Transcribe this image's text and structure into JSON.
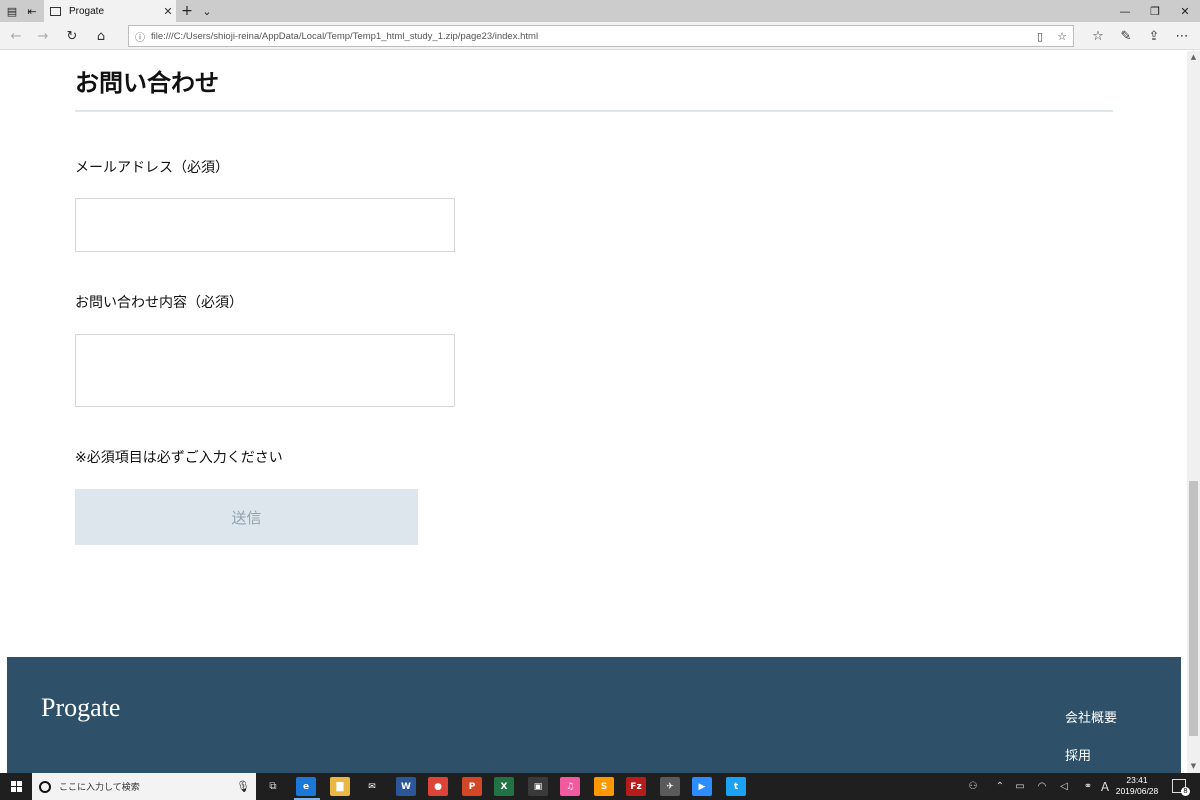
{
  "browser": {
    "tab_title": "Progate",
    "tab_close": "✕",
    "new_tab": "+",
    "tab_list": "⌄",
    "url": "file:///C:/Users/shioji-reina/AppData/Local/Temp/Temp1_html_study_1.zip/page23/index.html"
  },
  "page": {
    "heading": "お問い合わせ",
    "email_label": "メールアドレス（必須）",
    "email_value": "",
    "message_label": "お問い合わせ内容（必須）",
    "message_value": "",
    "required_note": "※必須項目は必ずご入力ください",
    "submit_label": "送信"
  },
  "footer": {
    "logo": "Progate",
    "links": [
      "会社概要",
      "採用"
    ]
  },
  "taskbar": {
    "search_placeholder": "ここに入力して検索",
    "apps": [
      {
        "name": "edge",
        "glyph": "e",
        "color": "#1c78d6"
      },
      {
        "name": "file-explorer",
        "glyph": "▇",
        "color": "#e8b842"
      },
      {
        "name": "mail",
        "glyph": "✉",
        "color": "#1f1f1f"
      },
      {
        "name": "word",
        "glyph": "W",
        "color": "#2b579a"
      },
      {
        "name": "chrome",
        "glyph": "●",
        "color": "#db4437"
      },
      {
        "name": "powerpoint",
        "glyph": "P",
        "color": "#d24726"
      },
      {
        "name": "excel",
        "glyph": "X",
        "color": "#217346"
      },
      {
        "name": "photos",
        "glyph": "▣",
        "color": "#3a3a3a"
      },
      {
        "name": "itunes",
        "glyph": "♫",
        "color": "#f15a9e"
      },
      {
        "name": "sublime",
        "glyph": "S",
        "color": "#ff9800"
      },
      {
        "name": "filezilla",
        "glyph": "Fz",
        "color": "#b71c1c"
      },
      {
        "name": "app-bird",
        "glyph": "✈",
        "color": "#5a5a5a"
      },
      {
        "name": "zoom",
        "glyph": "▶",
        "color": "#2d8cff"
      },
      {
        "name": "twitter",
        "glyph": "t",
        "color": "#1da1f2"
      }
    ],
    "time": "23:41",
    "date": "2019/06/28",
    "ime": "A",
    "notification_count": "8"
  }
}
